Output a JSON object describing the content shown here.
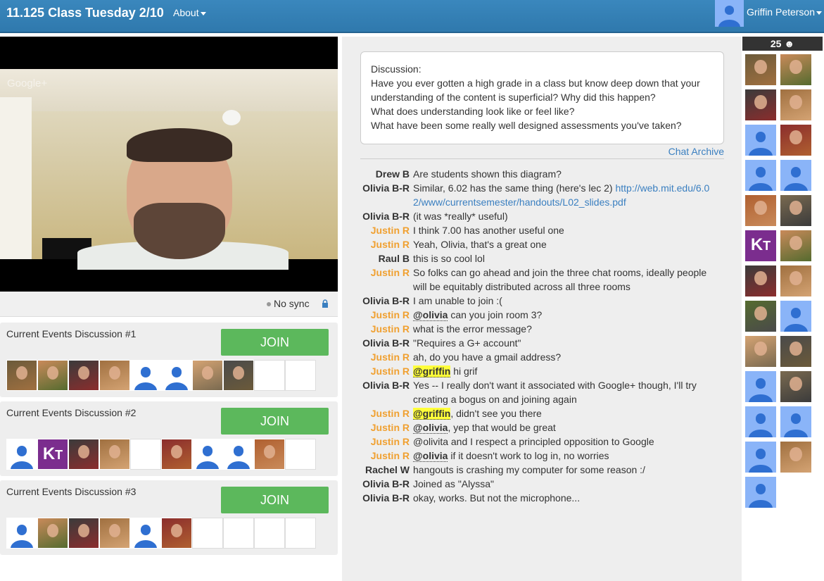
{
  "header": {
    "title": "11.125 Class Tuesday 2/10",
    "about_label": "About",
    "user_name": "Griffin Peterson"
  },
  "video": {
    "logo_text": "Google+",
    "sync_label": "No sync"
  },
  "rooms": [
    {
      "name": "Current Events Discussion #1",
      "join_label": "JOIN",
      "slots": [
        "photo",
        "photo",
        "photo",
        "photo",
        "placeholder",
        "placeholder",
        "photo",
        "photo",
        "empty",
        "empty"
      ]
    },
    {
      "name": "Current Events Discussion #2",
      "join_label": "JOIN",
      "slots": [
        "placeholder",
        "kt",
        "photo",
        "photo",
        "empty",
        "photo",
        "placeholder",
        "placeholder",
        "photo",
        "empty"
      ]
    },
    {
      "name": "Current Events Discussion #3",
      "join_label": "JOIN",
      "slots": [
        "placeholder",
        "photo",
        "photo",
        "photo",
        "placeholder",
        "photo",
        "empty",
        "empty",
        "empty",
        "empty"
      ]
    }
  ],
  "discussion": {
    "lines": [
      "Discussion:",
      "Have you ever gotten a high grade in a class but know deep down that your understanding of the content is superficial? Why did this happen?",
      "What does understanding look like or feel like?",
      "What have been some really well designed assessments you've taken?"
    ],
    "archive_label": "Chat Archive"
  },
  "chat": [
    {
      "who": "Drew B",
      "staff": false,
      "parts": [
        {
          "t": "Are students shown this diagram?"
        }
      ]
    },
    {
      "who": "Olivia B-R",
      "staff": false,
      "parts": [
        {
          "t": "Similar, 6.02 has the same thing (here's lec 2) "
        },
        {
          "t": "http://web.mit.edu/6.02/www/currentsemester/handouts/L02_slides.pdf",
          "link": true
        }
      ]
    },
    {
      "who": "Olivia B-R",
      "staff": false,
      "parts": [
        {
          "t": "(it was *really* useful)"
        }
      ]
    },
    {
      "who": "Justin R",
      "staff": true,
      "parts": [
        {
          "t": "I think 7.00 has another useful one"
        }
      ]
    },
    {
      "who": "Justin R",
      "staff": true,
      "parts": [
        {
          "t": "Yeah, Olivia, that's a great one"
        }
      ]
    },
    {
      "who": "Raul B",
      "staff": false,
      "parts": [
        {
          "t": "this is so cool lol"
        }
      ]
    },
    {
      "who": "Justin R",
      "staff": true,
      "parts": [
        {
          "t": "So folks can go ahead and join the three chat rooms, ideally people will be equitably distributed across all three rooms"
        }
      ]
    },
    {
      "who": "Olivia B-R",
      "staff": false,
      "parts": [
        {
          "t": "I am unable to join :("
        }
      ]
    },
    {
      "who": "Justin R",
      "staff": true,
      "parts": [
        {
          "t": "@olivia",
          "mention": true
        },
        {
          "t": " can you join room 3?"
        }
      ]
    },
    {
      "who": "Justin R",
      "staff": true,
      "parts": [
        {
          "t": "what is the error message?"
        }
      ]
    },
    {
      "who": "Olivia B-R",
      "staff": false,
      "parts": [
        {
          "t": "\"Requires a G+ account\""
        }
      ]
    },
    {
      "who": "Justin R",
      "staff": true,
      "parts": [
        {
          "t": "ah, do you have a gmail address?"
        }
      ]
    },
    {
      "who": "Justin R",
      "staff": true,
      "parts": [
        {
          "t": "@griffin",
          "mention": true,
          "hl": true
        },
        {
          "t": " hi grif"
        }
      ]
    },
    {
      "who": "Olivia B-R",
      "staff": false,
      "parts": [
        {
          "t": "Yes -- I really don't want it associated with Google+ though, I'll try creating a bogus on and joining again"
        }
      ]
    },
    {
      "who": "Justin R",
      "staff": true,
      "parts": [
        {
          "t": "@griffin",
          "mention": true,
          "hl": true
        },
        {
          "t": ", didn't see you there"
        }
      ]
    },
    {
      "who": "Justin R",
      "staff": true,
      "parts": [
        {
          "t": "@olivia",
          "mention": true
        },
        {
          "t": ", yep that would be great"
        }
      ]
    },
    {
      "who": "Justin R",
      "staff": true,
      "parts": [
        {
          "t": "@olivita and I respect a principled opposition to Google"
        }
      ]
    },
    {
      "who": "Justin R",
      "staff": true,
      "parts": [
        {
          "t": "@olivia",
          "mention": true
        },
        {
          "t": " if it doesn't work to log in, no worries"
        }
      ]
    },
    {
      "who": "Rachel W",
      "staff": false,
      "parts": [
        {
          "t": "hangouts is crashing my computer for some reason :/"
        }
      ]
    },
    {
      "who": "Olivia B-R",
      "staff": false,
      "parts": [
        {
          "t": "Joined as \"Alyssa\""
        }
      ]
    },
    {
      "who": "Olivia B-R",
      "staff": false,
      "parts": [
        {
          "t": "okay, works. But not the microphone..."
        }
      ]
    }
  ],
  "participants": {
    "count": "25",
    "tiles": [
      "photo",
      "photo",
      "photo",
      "photo",
      "placeholder",
      "photo",
      "placeholder",
      "placeholder",
      "photo",
      "photo",
      "kt",
      "photo",
      "photo",
      "photo",
      "photo",
      "placeholder",
      "photo",
      "photo",
      "placeholder",
      "photo",
      "placeholder",
      "placeholder",
      "placeholder",
      "photo",
      "placeholder"
    ]
  },
  "colors": {
    "header": "#3a87bd",
    "join_button": "#5cb85c",
    "staff_name": "#f0a030",
    "link": "#3a7fc0",
    "mention_highlight": "#ffff3a",
    "placeholder_avatar": "#8ab4f8"
  }
}
